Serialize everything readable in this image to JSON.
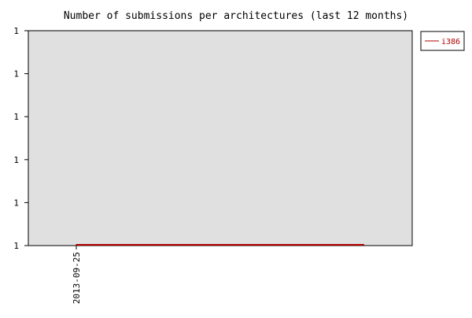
{
  "chart_data": {
    "type": "line",
    "title": "Number of submissions per architectures (last 12 months)",
    "xlabel": "",
    "ylabel": "",
    "x": [
      "2013-09-25"
    ],
    "y_tick_labels": [
      "1",
      "1",
      "1",
      "1",
      "1",
      "1"
    ],
    "ylim": [
      1,
      1
    ],
    "grid": false,
    "legend_position": "top-right",
    "plot_background": "#e0e0e0",
    "series": [
      {
        "name": "i386",
        "color": "#b00000",
        "values": [
          1
        ]
      }
    ]
  }
}
